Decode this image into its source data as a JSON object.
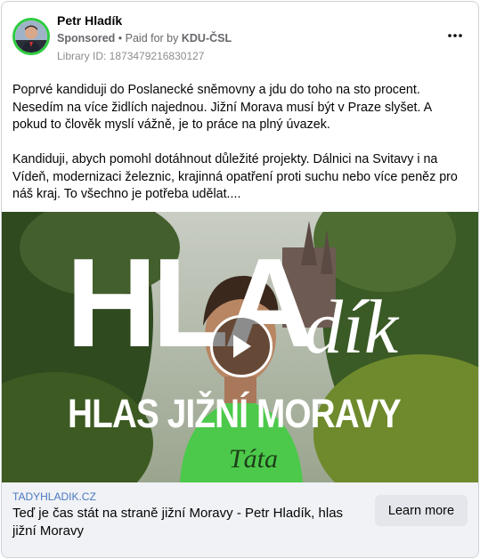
{
  "post": {
    "author": "Petr Hladík",
    "sponsored_label": "Sponsored",
    "separator": " • ",
    "paid_for_prefix": "Paid for by ",
    "payer": "KDU-ČSL",
    "library_id": "Library ID: 1873479216830127",
    "more_icon": "more-horizontal-icon"
  },
  "body": {
    "paragraph_1": "Poprvé kandiduji do Poslanecké sněmovny a jdu do toho na sto procent. Nesedím na více židlích najednou. Jižní Morava musí být v Praze slyšet. A pokud to člověk myslí vážně, je to práce na plný úvazek.",
    "paragraph_2": "Kandiduji, abych pomohl dotáhnout důležité projekty. Dálnici na Svitavy i na Vídeň, modernizaci železnic, krajinná opatření proti suchu nebo více peněz pro náš kraj. To všechno je potřeba udělat...."
  },
  "media": {
    "title_big": "HLA",
    "title_script": "dík",
    "slogan": "HLAS JIŽNÍ MORAVY",
    "shirt_text": "Táta",
    "play_icon": "play-icon"
  },
  "link": {
    "domain": "TADYHLADIK.CZ",
    "headline": "Teď je čas stát na straně jižní Moravy - Petr Hladík, hlas jižní Moravy",
    "cta_label": "Learn more"
  },
  "colors": {
    "avatar_ring": "#2ecc40",
    "shirt": "#4cc94a",
    "footer_bg": "#f0f2f5",
    "domain_text": "#4a78c2"
  }
}
